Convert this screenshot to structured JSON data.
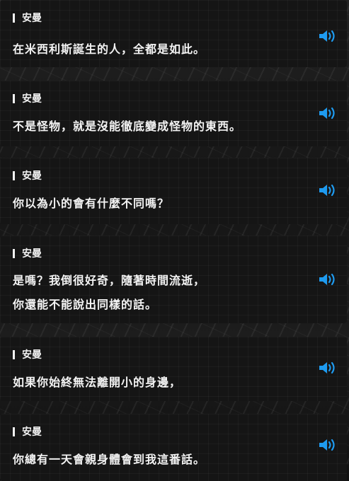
{
  "dialogue": [
    {
      "speaker": "安曼",
      "lines": [
        "在米西利斯誕生的人，全都是如此。"
      ]
    },
    {
      "speaker": "安曼",
      "lines": [
        "不是怪物，就是沒能徹底變成怪物的東西。"
      ]
    },
    {
      "speaker": "安曼",
      "lines": [
        "你以為小的會有什麼不同嗎？"
      ]
    },
    {
      "speaker": "安曼",
      "lines": [
        "是嗎？我倒很好奇，隨著時間流逝，",
        "你還能不能說出同樣的話。"
      ]
    },
    {
      "speaker": "安曼",
      "lines": [
        "如果你始終無法離開小的身邊，"
      ]
    },
    {
      "speaker": "安曼",
      "lines": [
        "你總有一天會親身體會到我這番話。"
      ]
    }
  ],
  "icons": {
    "voice": "speaker-volume-icon"
  },
  "colors": {
    "accent": "#1e9bf0",
    "card": "#151515",
    "text": "#f4f4f4"
  }
}
